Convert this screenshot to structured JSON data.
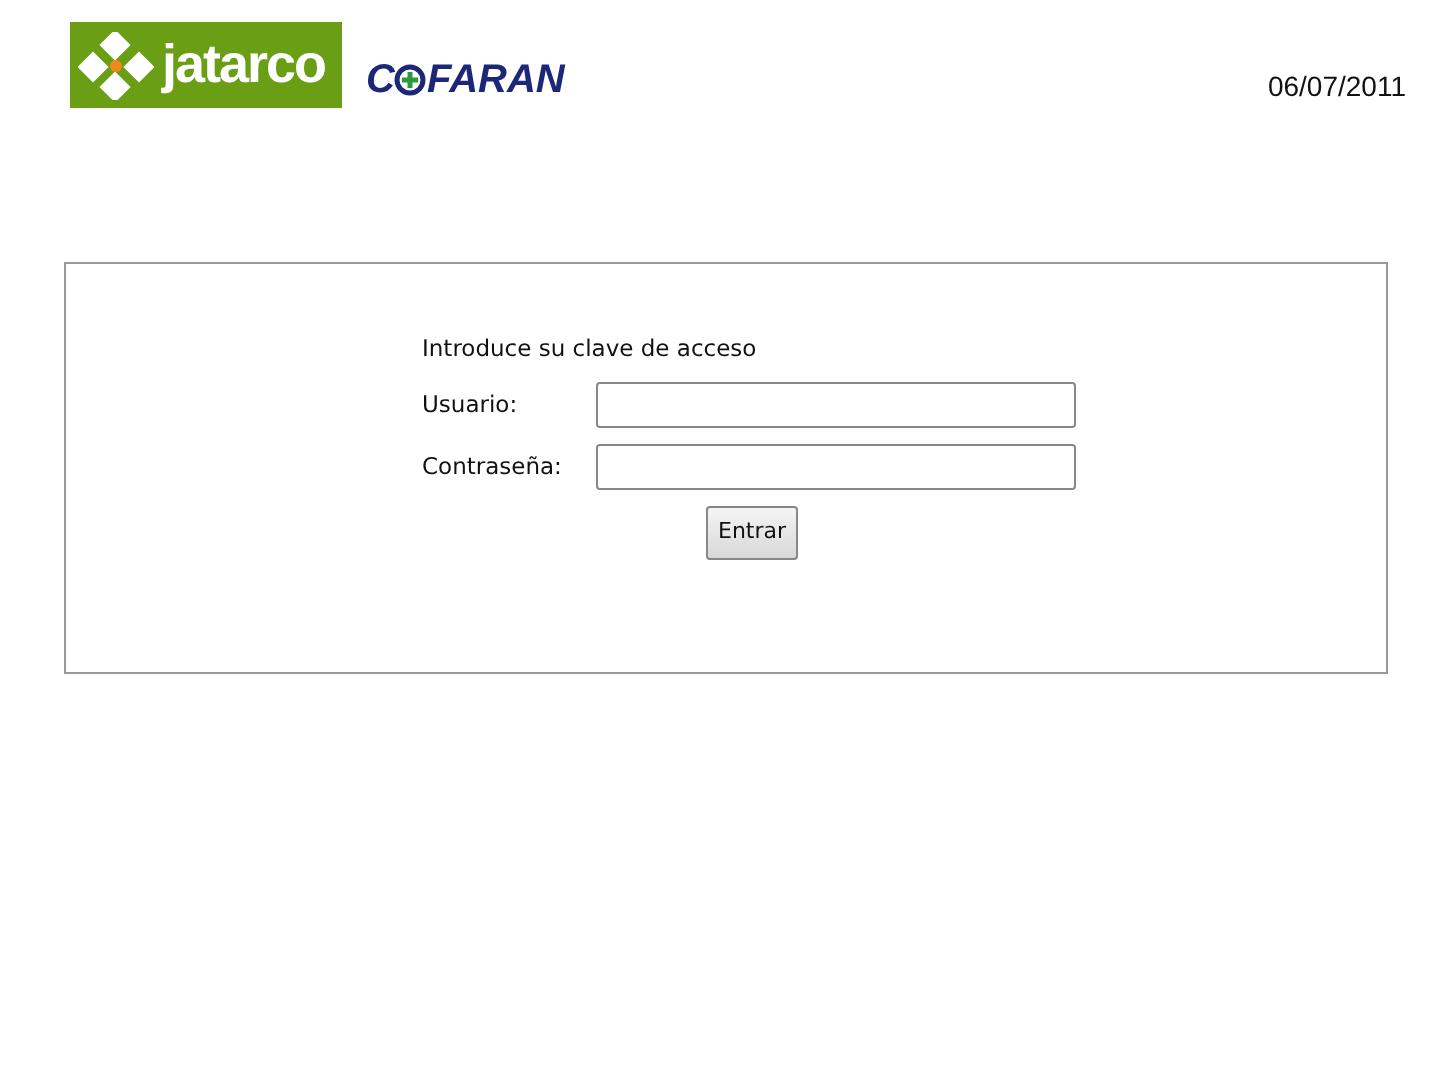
{
  "header": {
    "logo_primary": "jatarco",
    "logo_secondary_parts": [
      "C",
      "FARAN"
    ],
    "date": "06/07/2011"
  },
  "login": {
    "heading": "Introduce su clave de acceso",
    "fields": [
      {
        "label": "Usuario:"
      },
      {
        "label": "Contraseña:"
      }
    ],
    "button": "Entrar"
  }
}
